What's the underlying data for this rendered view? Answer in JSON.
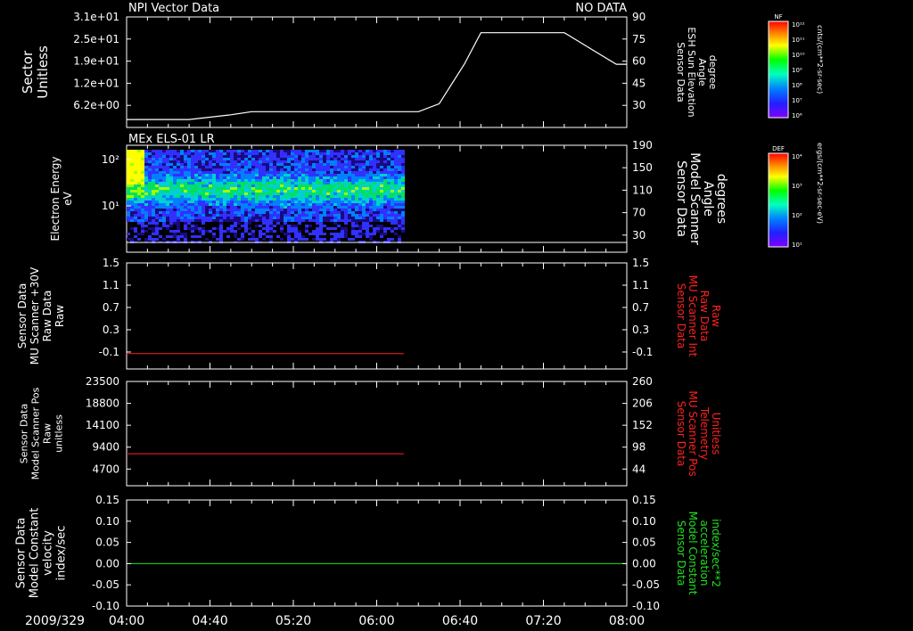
{
  "header": {
    "title": "NPI Vector Data",
    "status": "NO DATA",
    "spectrogram_title": "MEx ELS-01 LR"
  },
  "time_axis": {
    "start": "04:00",
    "end": "08:00",
    "date_label": "2009/329",
    "tick_labels": [
      "04:00",
      "04:40",
      "05:20",
      "06:00",
      "06:40",
      "07:20",
      "08:00"
    ]
  },
  "panels": {
    "p1": {
      "left_label": [
        "Sector",
        "Unitless"
      ],
      "left_ticks": [
        "3.1e+01",
        "2.5e+01",
        "1.9e+01",
        "1.2e+01",
        "6.2e+00"
      ],
      "right_label": [
        "Sensor Data",
        "ESH Sun Elevation",
        "Angle",
        "degree"
      ],
      "right_ticks": [
        "90",
        "75",
        "60",
        "45",
        "30"
      ],
      "colorbar_tag": "NF",
      "colorbar_unit": "cnts/(cm**2-sr-sec)",
      "colorbar_ticks": [
        "10¹²",
        "10¹¹",
        "10¹⁰",
        "10⁹",
        "10⁸",
        "10⁷",
        "10⁶"
      ]
    },
    "p2": {
      "left_label": [
        "Electron Energy",
        "eV"
      ],
      "left_ticks": [
        "10²",
        "10¹"
      ],
      "right_label": [
        "Sensor Data",
        "Model Scanner",
        "Angle",
        "degrees"
      ],
      "right_ticks": [
        "190",
        "150",
        "110",
        "70",
        "30"
      ],
      "colorbar_tag": "DEF",
      "colorbar_unit": "ergs/(cm**2-sr-sec-eV)",
      "colorbar_ticks": [
        "10⁴",
        "10³",
        "10²",
        "10¹"
      ]
    },
    "p3": {
      "left_label": [
        "Sensor Data",
        "MU Scanner +30V",
        "Raw Data",
        "Raw"
      ],
      "left_ticks": [
        "1.5",
        "1.1",
        "0.7",
        "0.3",
        "-0.1"
      ],
      "right_label": [
        "Sensor Data",
        "MU Scanner Int",
        "Raw Data",
        "Raw"
      ],
      "right_ticks": [
        "1.5",
        "1.1",
        "0.7",
        "0.3",
        "-0.1"
      ]
    },
    "p4": {
      "left_label": [
        "Sensor Data",
        "Model Scanner Pos",
        "Raw",
        "unitless"
      ],
      "left_ticks": [
        "23500",
        "18800",
        "14100",
        "9400",
        "4700"
      ],
      "right_label": [
        "Sensor Data",
        "MU Scanner Pos",
        "Telemetry",
        "Unitless"
      ],
      "right_ticks": [
        "260",
        "206",
        "152",
        "98",
        "44"
      ]
    },
    "p5": {
      "left_label": [
        "Sensor Data",
        "Model Constant",
        "velocity",
        "index/sec"
      ],
      "left_ticks": [
        "0.15",
        "0.10",
        "0.05",
        "0.00",
        "-0.05",
        "-0.10"
      ],
      "right_label": [
        "Sensor Data",
        "Model Constant",
        "acceleration",
        "index/sec**2"
      ],
      "right_ticks": [
        "0.15",
        "0.10",
        "0.05",
        "0.00",
        "-0.05",
        "-0.10"
      ]
    }
  },
  "colors": {
    "background": "#000000",
    "axes": "#ffffff",
    "red_trace": "#ff2020",
    "green_trace": "#20e020",
    "red_label": "#ff2020",
    "green_label": "#20e020"
  },
  "chart_data": [
    {
      "type": "line",
      "panel": "p1",
      "xlabel": "",
      "ylabel": "Sensor Data ESH Sun Elevation Angle degree",
      "ylim": [
        20,
        90
      ],
      "series": [
        {
          "x": [
            "04:00",
            "04:30",
            "04:50",
            "05:00",
            "05:30",
            "06:00",
            "06:20",
            "06:30",
            "06:42",
            "06:50",
            "07:00",
            "07:20",
            "07:30",
            "07:45",
            "07:55",
            "08:00"
          ],
          "values": [
            25,
            25,
            28,
            30,
            30,
            30,
            30,
            35,
            60,
            80,
            80,
            80,
            80,
            68,
            60,
            60
          ]
        }
      ]
    },
    {
      "type": "heatmap",
      "panel": "p2",
      "xlabel": "",
      "ylabel": "Electron Energy eV",
      "ylim": [
        1.3,
        200
      ],
      "xrange": [
        "04:00",
        "06:13"
      ],
      "scale": "log",
      "description_values": {
        "peak_band_energy_eV": 18,
        "hot_spot_end": "04:07"
      }
    },
    {
      "type": "line",
      "panel": "p3",
      "ylim": [
        -0.3,
        1.5
      ],
      "series": [
        {
          "x": [
            "04:00",
            "06:13"
          ],
          "values": [
            -0.04,
            -0.04
          ]
        }
      ]
    },
    {
      "type": "line",
      "panel": "p4",
      "ylim": [
        0,
        23500
      ],
      "series": [
        {
          "x": [
            "04:00",
            "06:13"
          ],
          "values": [
            7200,
            7200
          ]
        }
      ]
    },
    {
      "type": "line",
      "panel": "p5",
      "ylim": [
        -0.1,
        0.15
      ],
      "series": [
        {
          "x": [
            "04:00",
            "08:00"
          ],
          "values": [
            0.0,
            0.0
          ]
        }
      ]
    }
  ]
}
